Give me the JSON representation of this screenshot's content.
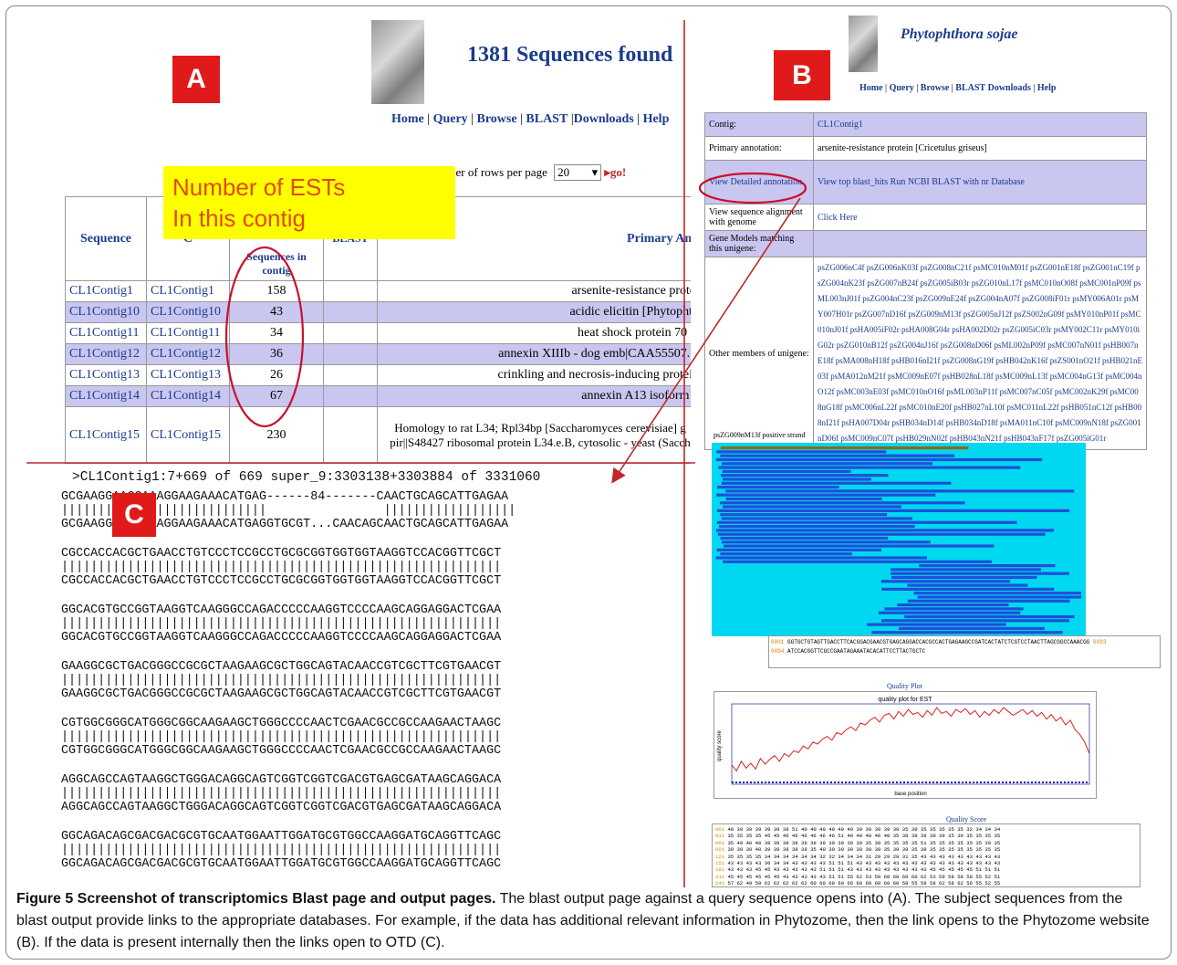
{
  "figure": {
    "caption_label": "Figure 5 Screenshot of transcriptomics Blast page and output pages.",
    "caption_text": " The blast output page against a query sequence opens into (A). The subject sequences from the blast output provide links to the appropriate databases. For example, if the data has additional relevant information in Phytozome, then the link opens to the Phytozome website (B). If the data is present internally then the links open to OTD (C)."
  },
  "panel_a": {
    "badge": "A",
    "title": "1381 Sequences found",
    "nav": [
      "Home",
      "Query",
      "Browse",
      "BLAST",
      "Downloads",
      "Help"
    ],
    "rows_label": "Number of rows per page",
    "rows_value": "20",
    "go_label": "go!",
    "note_line1": "Number of ESTs",
    "note_line2": "In this contig",
    "headers": {
      "sequence": "Sequence",
      "contig_partial": "C",
      "seq_in_contig": "Sequences in contig",
      "blast_partial": "BLAST",
      "primary": "Primary Ann"
    },
    "rows": [
      {
        "seq": "CL1Contig1",
        "contig": "CL1Contig1",
        "count": "158",
        "ann": "arsenite-resistance protei"
      },
      {
        "seq": "CL1Contig10",
        "contig": "CL1Contig10",
        "count": "43",
        "ann": "acidic elicitin [Phytophth"
      },
      {
        "seq": "CL1Contig11",
        "contig": "CL1Contig11",
        "count": "34",
        "ann": "heat shock protein 70 [("
      },
      {
        "seq": "CL1Contig12",
        "contig": "CL1Contig12",
        "count": "36",
        "ann": "annexin XIIIb - dog emb|CAA55507.1|"
      },
      {
        "seq": "CL1Contig13",
        "contig": "CL1Contig13",
        "count": "26",
        "ann": "crinkling and necrosis-inducing protein"
      },
      {
        "seq": "CL1Contig14",
        "contig": "CL1Contig14",
        "count": "67",
        "ann": "annexin A13 isoform b"
      },
      {
        "seq": "CL1Contig15",
        "contig": "CL1Contig15",
        "count": "230",
        "ann": "Homology to rat L34; Rpl34bp [Saccharomyces cerevisiae] g pir||S48427 ribosomal protein L34.e.B, cytosolic - yeast (Sacch"
      }
    ]
  },
  "panel_b": {
    "badge": "B",
    "title": "Phytophthora sojae",
    "nav": [
      "Home",
      "Query",
      "Browse",
      "BLAST",
      "Downloads",
      "Help"
    ],
    "rows": [
      {
        "label": "Contig:",
        "value": "CL1Contig1"
      },
      {
        "label": "Primary annotation:",
        "value": "arsenite-resistance protein [Cricetulus griseus]"
      },
      {
        "label": "View Detailed annotation",
        "value": "View top blast_hits    Run NCBI BLAST with nr Database"
      },
      {
        "label": "View sequence alignment with genome",
        "value": "Click Here"
      },
      {
        "label": "Gene Models matching this unigene:",
        "value": ""
      },
      {
        "label": "Other members of unigene:",
        "value": "psZG006nC4f psZG006nK03f psZG008nC21f psMC010nM01f psZG001nE18f psZG001nC19f psZG004nK23f psZG007nB24f psZG005iB03r psZG010nL17f psMC010nO08f psMC001nP09f psML003nJ01f psZG004nC23f psZG009nE24f psZG004nA07f psZG008iF01r psMY006A01r psMY007H01r psZG007nD16f psZG009nM13f psZG005nJ12f psZS002nG09f psMY010nP01f psMC010nJ01f psHA005iF02r psHA008G04r psHA002D02r psZG005iC03r psMY002C11r psMY010iG02r psZG010nB12f psZG004nJ16f psZG008nD06f psML002nP09f psMC007nN01f psHB007nE18f psMA008nH18f psHB016nI21f psZG008nG19f psHB042nK16f psZS001nO21f psHB021nE03f psMA012nM21f psMC009nE07f psHB028nL18f psMC009nL13f psMC004nG13f psMC004nO12f psMC003nE03f psMC010nO16f psML003nP11f psMC007nC05f psMC002nK29f psMC008nG18f psMC006nL22f psMC010nE20f psHB027nL10f psMC011nL22f psHB051nC12f psHB008nI21f psHA007D04r psHB034nD14f psHB034nD18f psMA011nC10f psMC009nN18f psZG001nD06f psMC009nC07f psHB029nN02f psHB043nN21f psHB043nF17f psZG005iG01r"
      }
    ],
    "strand_label": "psZG009nM13f positive strand",
    "seq_line_1": "GGTGCTGTAGTTGACCTTCACGGACGAACGTGAGCAGGACCACGCCACTGAGAAGCCGATCACTATCTCGTCCTAACTTAGCGGCCAAACGG",
    "seq_line_2": "ATCCACGGTTCGCCGAATAGAAATACACATTCCTTACTGCTC",
    "seq_num_1": "0001",
    "seq_num_2": "0094",
    "seq_num_end": "0093",
    "quality_plot_title": "Quality Plot",
    "quality_plot_inner": "quality plot for EST",
    "quality_ylabel": "quality score",
    "quality_xlabel": "base position",
    "quality_values": [
      18,
      12,
      22,
      15,
      20,
      14,
      25,
      19,
      24,
      28,
      22,
      30,
      27,
      33,
      31,
      38,
      35,
      42,
      40,
      45,
      48,
      44,
      52,
      50,
      55,
      58,
      54,
      62,
      60,
      65,
      68,
      63,
      70,
      72,
      66,
      74,
      69,
      76,
      71,
      73,
      68,
      75,
      70,
      78,
      72,
      74,
      69,
      76,
      73,
      77,
      71,
      75,
      68,
      74,
      70,
      76,
      72,
      78,
      74,
      70,
      73,
      76,
      71,
      75,
      69,
      73,
      66,
      71,
      64,
      68,
      60,
      65,
      55,
      50,
      42,
      30
    ],
    "quality_score_title": "Quality Score",
    "quality_rows": [
      "40 39 39 39 39 39 39 51 40 40 40 40 40 40 39 39 39 39 39 35 39 35 35 35 35 35 32 34 34 34",
      "35 35 35 35 45 45 46 46 46 46 46 46 51 40 40 40 40 40 35 39 39 39 39 39 35 39 35 35 35 35",
      "35 40 40 40 39 39 39 39 39 39 39 39 39 39 39 35 39 35 35 35 35 51 35 35 35 35 35 35 39 35",
      "39 39 39 40 39 39 39 39 39 35 40 39 39 39 39 39 39 35 39 39 35 39 35 35 35 35 35 35 35 35",
      "35 35 35 35 34 34 34 34 34 34 32 32 34 34 34 31 29 29 29 31 35 43 43 43 43 43 43 43 43 43",
      "43 43 43 43 36 34 34 43 43 43 43 51 51 51 43 43 43 43 43 43 43 43 43 43 43 43 43 43 43 43",
      "43 43 43 45 45 43 43 43 43 43 51 51 51 43 43 43 43 43 43 43 43 43 45 45 45 45 45 51 51 51",
      "45 45 45 45 45 45 43 43 43 43 43 51 51 55 62 53 59 60 60 60 60 62 53 59 58 58 58 55 52 51",
      "57 62 49 59 62 62 62 62 62 60 60 60 60 66 60 60 60 60 60 58 55 58 58 62 58 62 56 55 52 55"
    ],
    "quality_row_nums": [
      "001",
      "031",
      "061",
      "091",
      "121",
      "151",
      "181",
      "211",
      "241"
    ]
  },
  "panel_c": {
    "badge": "C",
    "header": ">CL1Contig1:7+669 of 669 super_9:3303138+3303884 of 3331060",
    "blocks": [
      {
        "top": "GCGAAGGAAGGAAAGGAAGAAACATGAG------84-------CAACTGCAGCATTGAGAA",
        "mid": "||||||||||||||||||||||||||||                ||||||||||||||||||",
        "bot": "GCGAAGGAAGGAAAGGAAGAAACATGAGGTGCGT...CAACAGCAACTGCAGCATTGAGAA"
      },
      {
        "top": "CGCCACCACGCTGAACCTGTCCCTCCGCCTGCGCGGTGGTGGTAAGGTCCACGGTTCGCT",
        "mid": "||||||||||||||||||||||||||||||||||||||||||||||||||||||||||||",
        "bot": "CGCCACCACGCTGAACCTGTCCCTCCGCCTGCGCGGTGGTGGTAAGGTCCACGGTTCGCT"
      },
      {
        "top": "GGCACGTGCCGGTAAGGTCAAGGGCCAGACCCCCAAGGTCCCCAAGCAGGAGGACTCGAA",
        "mid": "||||||||||||||||||||||||||||||||||||||||||||||||||||||||||||",
        "bot": "GGCACGTGCCGGTAAGGTCAAGGGCCAGACCCCCAAGGTCCCCAAGCAGGAGGACTCGAA"
      },
      {
        "top": "GAAGGCGCTGACGGGCCGCGCTAAGAAGCGCTGGCAGTACAACCGTCGCTTCGTGAACGT",
        "mid": "||||||||||||||||||||||||||||||||||||||||||||||||||||||||||||",
        "bot": "GAAGGCGCTGACGGGCCGCGCTAAGAAGCGCTGGCAGTACAACCGTCGCTTCGTGAACGT"
      },
      {
        "top": "CGTGGCGGGCATGGGCGGCAAGAAGCTGGGCCCCAACTCGAACGCCGCCAAGAACTAAGC",
        "mid": "||||||||||||||||||||||||||||||||||||||||||||||||||||||||||||",
        "bot": "CGTGGCGGGCATGGGCGGCAAGAAGCTGGGCCCCAACTCGAACGCCGCCAAGAACTAAGC"
      },
      {
        "top": "AGGCAGCCAGTAAGGCTGGGACAGGCAGTCGGTCGGTCGACGTGAGCGATAAGCAGGACA",
        "mid": "||||||||||||||||||||||||||||||||||||||||||||||||||||||||||||",
        "bot": "AGGCAGCCAGTAAGGCTGGGACAGGCAGTCGGTCGGTCGACGTGAGCGATAAGCAGGACA"
      },
      {
        "top": "GGCAGACAGCGACGACGCGTGCAATGGAATTGGATGCGTGGCCAAGGATGCAGGTTCAGC",
        "mid": "||||||||||||||||||||||||||||||||||||||||||||||||||||||||||||",
        "bot": "GGCAGACAGCGACGACGCGTGCAATGGAATTGGATGCGTGGCCAAGGATGCAGGTTCAGC"
      }
    ]
  },
  "colors": {
    "badge": "#e01a1a",
    "link": "#1a3c8c",
    "row_highlight": "#c9c6f0",
    "note_bg": "#ffff00",
    "note_text": "#e14b0a",
    "alignment_bg": "#00d7f0",
    "alignment_bar": "#1f4fd8",
    "divider": "#c0262a",
    "ellipse": "#c8102e"
  }
}
